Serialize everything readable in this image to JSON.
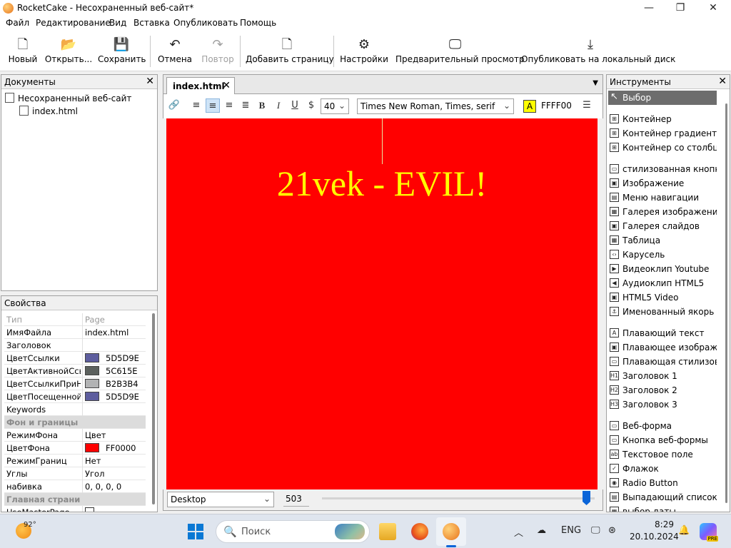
{
  "window": {
    "title": "RocketCake - Несохраненный веб-сайт*",
    "minimize": "—",
    "maximize": "❐",
    "close": "✕"
  },
  "menu": [
    "Файл",
    "Редактирование",
    "Вид",
    "Вставка",
    "Опубликовать",
    "Помощь"
  ],
  "toolbar": {
    "new": "Новый",
    "open": "Открыть...",
    "save": "Сохранить",
    "undo": "Отмена",
    "redo": "Повтор",
    "add_page": "Добавить страницу",
    "settings": "Настройки",
    "preview": "Предварительный просмотр",
    "publish_local": "Опубликовать на локальный диск"
  },
  "documents": {
    "title": "Документы",
    "site": "Несохраненный веб-сайт",
    "page": "index.html"
  },
  "properties": {
    "title": "Свойства",
    "header": {
      "key": "Тип",
      "value": "Page"
    },
    "rows": [
      {
        "key": "ИмяФайла",
        "value": "index.html"
      },
      {
        "key": "Заголовок",
        "value": ""
      },
      {
        "key": "ЦветСсылки",
        "value": "5D5D9E",
        "color": "#5D5D9E"
      },
      {
        "key": "ЦветАктивнойСсылки",
        "value": "5C615E",
        "color": "#5C615E"
      },
      {
        "key": "ЦветСсылкиПриНаведении",
        "value": "B2B3B4",
        "color": "#B2B3B4"
      },
      {
        "key": "ЦветПосещеннойСсылки",
        "value": "5D5D9E",
        "color": "#5D5D9E"
      },
      {
        "key": "Keywords",
        "value": ""
      }
    ],
    "section_bg": "Фон и границы",
    "rows_bg": [
      {
        "key": "РежимФона",
        "value": "Цвет"
      },
      {
        "key": "ЦветФона",
        "value": "FF0000",
        "color": "#FF0000"
      },
      {
        "key": "РежимГраниц",
        "value": "Нет"
      },
      {
        "key": "Углы",
        "value": "Угол"
      },
      {
        "key": "набивка",
        "value": "0, 0, 0, 0"
      }
    ],
    "section_main": "Главная страница",
    "last_row": {
      "key": "UseMasterPage"
    }
  },
  "editor": {
    "tab": "index.html",
    "font_size": "40",
    "font_family": "Times New Roman, Times, serif",
    "text_color_glyph": "A",
    "text_color_hex": "FFFF00",
    "canvas_bg": "#FF0000",
    "heading": "21vek - EVIL!",
    "view_mode": "Desktop",
    "width": "503",
    "width_fraction": 0.97
  },
  "tools": {
    "title": "Инструменты",
    "selected": "Выбор",
    "groups": [
      [
        "Контейнер",
        "Контейнер градиента",
        "Контейнер со столбцами"
      ],
      [
        "стилизованная кнопка",
        "Изображение",
        "Меню навигации",
        "Галерея изображений",
        "Галерея слайдов",
        "Таблица",
        "Карусель",
        "Видеоклип Youtube",
        "Аудиоклип HTML5",
        "HTML5 Video",
        "Именованный якорь"
      ],
      [
        "Плавающий текст",
        "Плавающее изображение",
        "Плавающая стилизованная кнопка",
        "Заголовок 1",
        "Заголовок 2",
        "Заголовок 3"
      ],
      [
        "Веб-форма",
        "Кнопка веб-формы",
        "Текстовое поле",
        "Флажок",
        "Radio Button",
        "Выпадающий список",
        "выбор даты"
      ]
    ]
  },
  "taskbar": {
    "temperature": "92°",
    "search_placeholder": "Поиск",
    "language": "ENG",
    "time": "8:29",
    "date": "20.10.2024",
    "copilot_badge": "PRE"
  }
}
